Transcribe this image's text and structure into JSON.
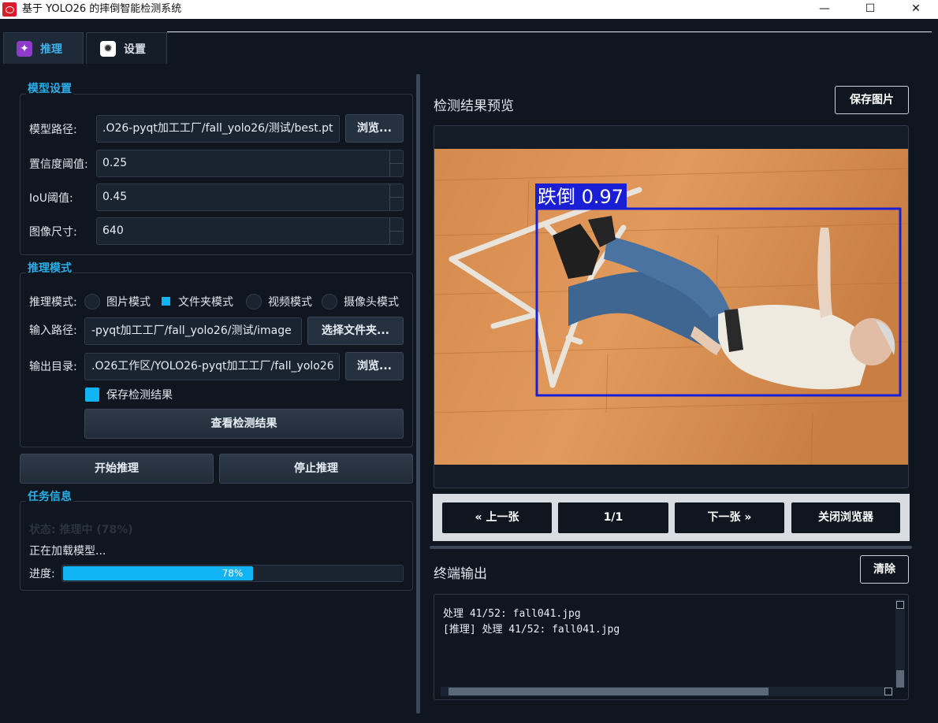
{
  "window": {
    "title": "基于 YOLO26 的摔倒智能检测系统",
    "controls": {
      "minimize": "—",
      "maximize": "☐",
      "close": "✕"
    }
  },
  "tabs": [
    {
      "label": "推理",
      "icon": "network-icon",
      "active": true
    },
    {
      "label": "设置",
      "icon": "gear-icon",
      "active": false
    }
  ],
  "model_settings": {
    "title": "模型设置",
    "model_path_label": "模型路径:",
    "model_path_value": ".O26-pyqt加工工厂/fall_yolo26/测试/best.pt",
    "browse_label": "浏览...",
    "confidence_label": "置信度阈值:",
    "confidence_value": "0.25",
    "iou_label": "IoU阈值:",
    "iou_value": "0.45",
    "image_size_label": "图像尺寸:",
    "image_size_value": "640"
  },
  "inference_mode": {
    "title": "推理模式",
    "mode_label": "推理模式:",
    "options": [
      "图片模式",
      "文件夹模式",
      "视频模式",
      "摄像头模式"
    ],
    "selected": "文件夹模式",
    "input_path_label": "输入路径:",
    "input_path_value": "-pyqt加工工厂/fall_yolo26/测试/image",
    "choose_folder_label": "选择文件夹...",
    "output_dir_label": "输出目录:",
    "output_dir_value": ".O26工作区/YOLO26-pyqt加工工厂/fall_yolo26",
    "output_browse_label": "浏览...",
    "save_results_label": "保存检测结果",
    "save_results_checked": true,
    "view_results_label": "查看检测结果"
  },
  "actions": {
    "start_label": "开始推理",
    "stop_label": "停止推理"
  },
  "task_info": {
    "title": "任务信息",
    "status_text": "状态: 推理中 (78%)",
    "message": "正在加载模型...",
    "progress_label": "进度:",
    "progress_value": 78,
    "progress_text": "78%"
  },
  "preview": {
    "title": "检测结果预览",
    "save_image_label": "保存图片",
    "detection_label": "跌倒 0.97",
    "box_color": "#1a1fd6"
  },
  "navigation": {
    "prev_label": "« 上一张",
    "page_indicator": "1/1",
    "next_label": "下一张 »",
    "close_label": "关闭浏览器"
  },
  "terminal": {
    "title": "终端输出",
    "clear_label": "清除",
    "lines": [
      "处理 41/52: fall041.jpg",
      "[推理] 处理 41/52: fall041.jpg"
    ]
  },
  "colors": {
    "accent": "#10b4f5",
    "group_title": "#29aee8",
    "background": "#0f161f"
  }
}
